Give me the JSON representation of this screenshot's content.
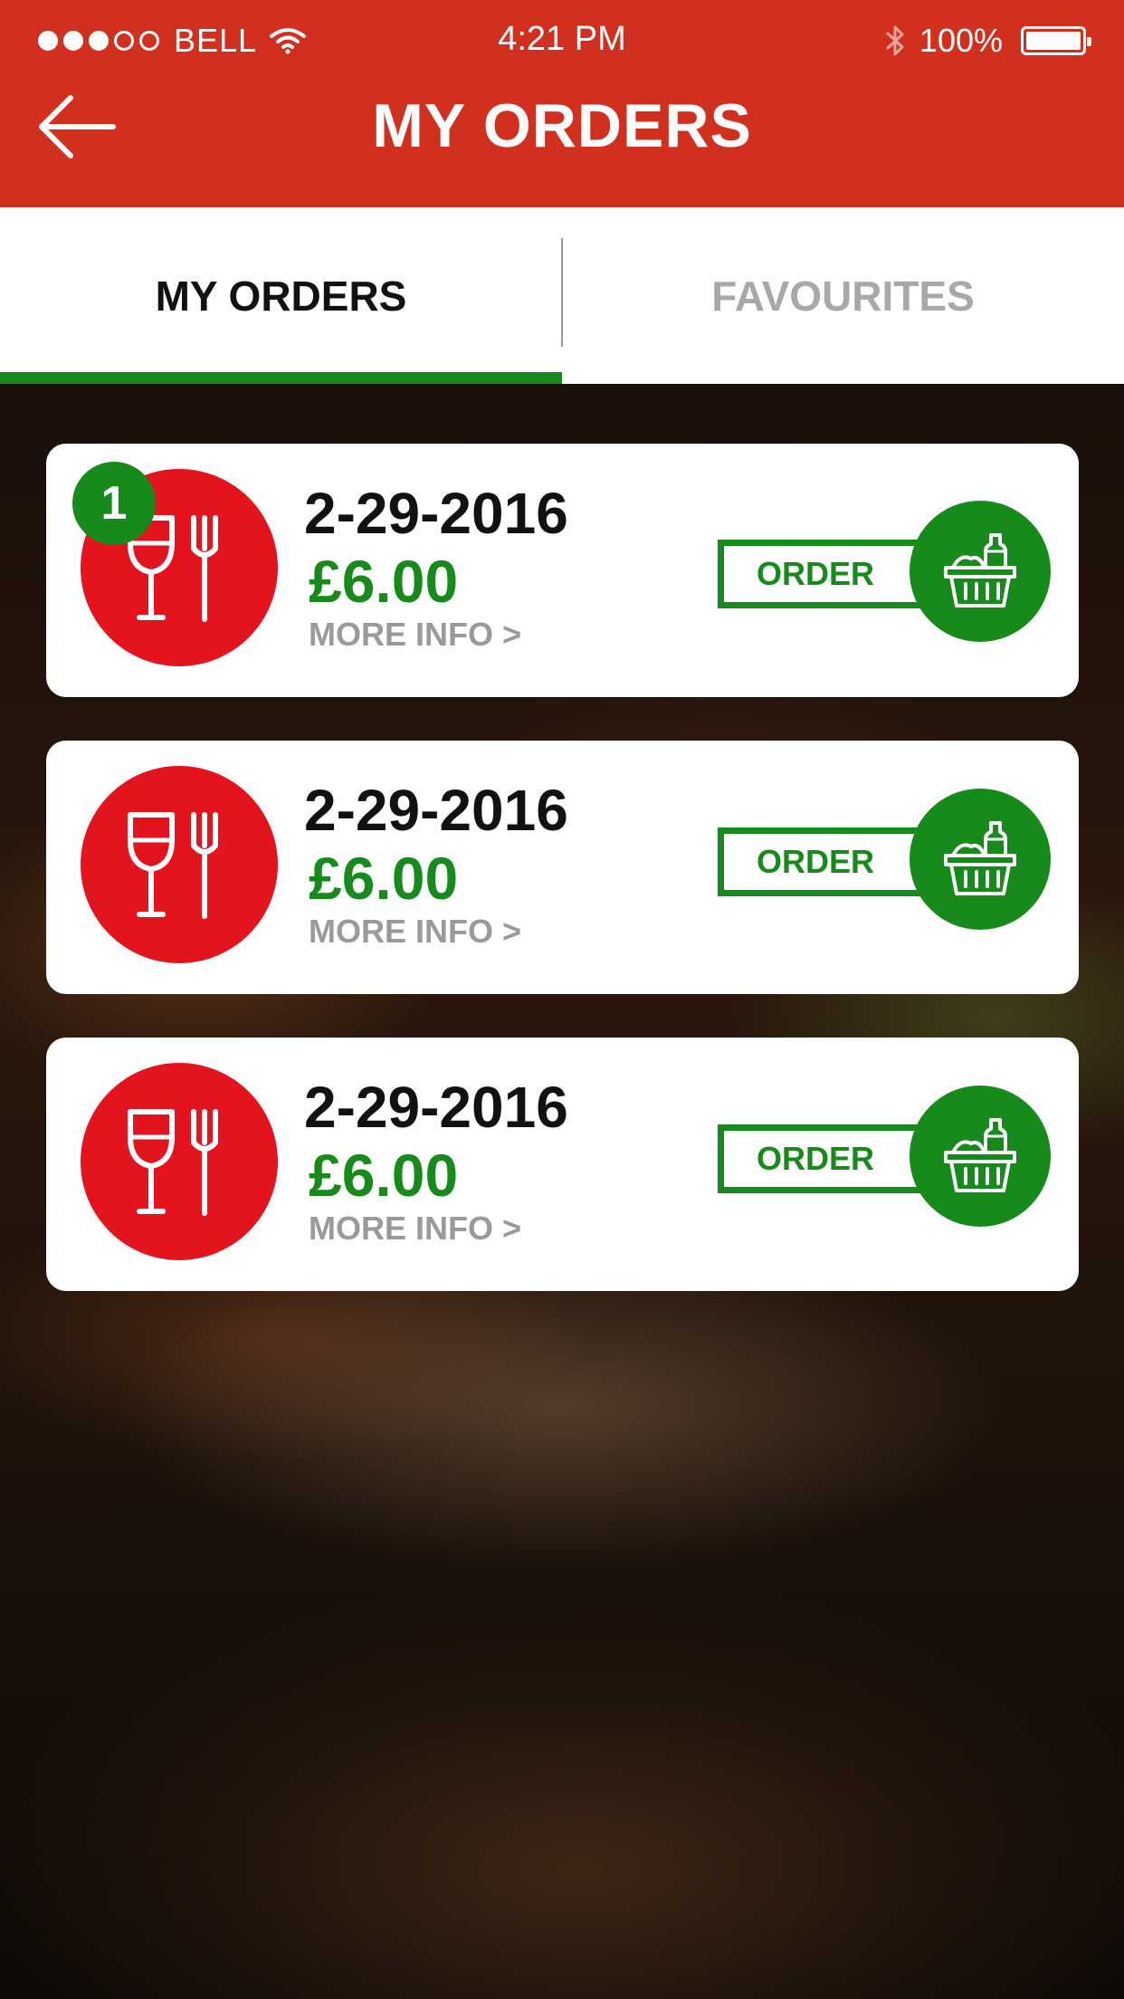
{
  "status_bar": {
    "carrier": "BELL",
    "time": "4:21 PM",
    "battery": "100%"
  },
  "header": {
    "title": "MY ORDERS"
  },
  "tabs": [
    {
      "label": "MY ORDERS",
      "active": true
    },
    {
      "label": "FAVOURITES",
      "active": false
    }
  ],
  "orders": [
    {
      "badge": "1",
      "date": "2-29-2016",
      "price": "£6.00",
      "more_info": "MORE INFO >",
      "order_label": "ORDER"
    },
    {
      "date": "2-29-2016",
      "price": "£6.00",
      "more_info": "MORE INFO >",
      "order_label": "ORDER"
    },
    {
      "date": "2-29-2016",
      "price": "£6.00",
      "more_info": "MORE INFO >",
      "order_label": "ORDER"
    }
  ],
  "colors": {
    "header_red": "#d2301f",
    "plate_red": "#e3141e",
    "accent_green": "#168a1a",
    "muted_gray": "#9a9a9a"
  },
  "icons": {
    "back": "arrow-left-icon",
    "plate": "wine-glass-fork-icon",
    "basket": "shopping-basket-icon"
  }
}
